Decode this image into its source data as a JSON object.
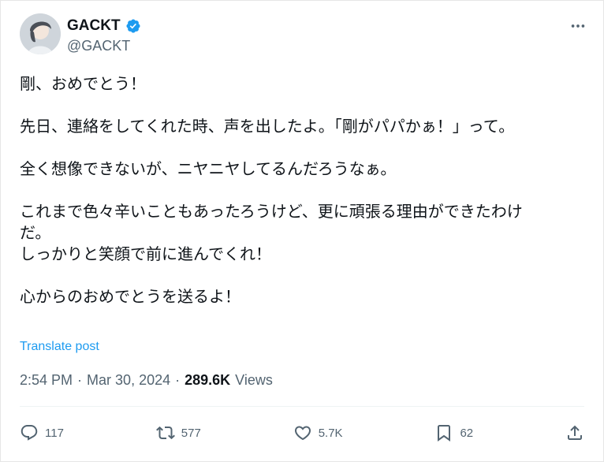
{
  "author": {
    "name": "GACKT",
    "handle": "@GACKT"
  },
  "post": {
    "lines": [
      "剛、おめでとう！",
      "",
      "先日、連絡をしてくれた時、声を出したよ。「剛がパパかぁ！」って。",
      "",
      "全く想像できないが、ニヤニヤしてるんだろうなぁ。",
      "",
      "これまで色々辛いこともあったろうけど、更に頑張る理由ができたわけ",
      "だ。",
      "しっかりと笑顔で前に進んでくれ！",
      "",
      "心からのおめでとうを送るよ！"
    ],
    "translate_label": "Translate post",
    "time": "2:54 PM",
    "date": "Mar 30, 2024",
    "views_count": "289.6K",
    "views_label": "Views"
  },
  "actions": {
    "replies": "117",
    "reposts": "577",
    "likes": "5.7K",
    "bookmarks": "62"
  },
  "icons": {
    "verified": "verified-badge-icon",
    "more": "more-icon",
    "reply": "reply-icon",
    "repost": "repost-icon",
    "like": "heart-icon",
    "bookmark": "bookmark-icon",
    "share": "share-icon"
  },
  "colors": {
    "accent": "#1d9bf0",
    "text": "#0f1419",
    "muted": "#536471"
  }
}
